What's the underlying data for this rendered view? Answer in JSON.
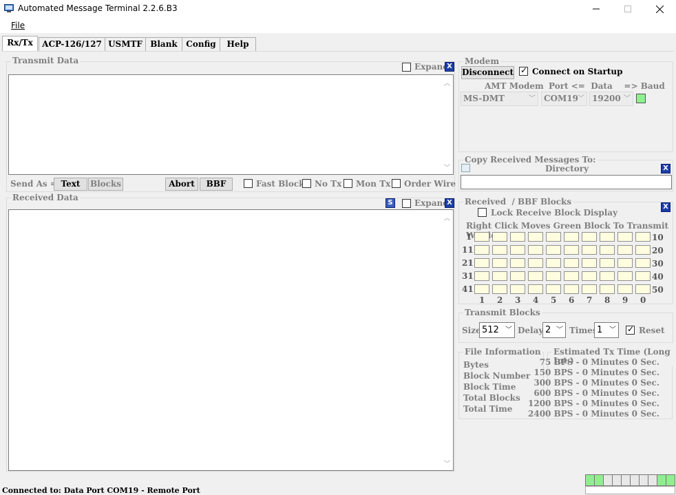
{
  "window": {
    "title": "Automated Message Terminal 2.2.6.B3"
  },
  "menu": {
    "file": "File"
  },
  "tabs": [
    "Rx/Tx",
    "ACP-126/127",
    "USMTF",
    "Blank",
    "Config",
    "Help"
  ],
  "transmit": {
    "label": "Transmit Data",
    "expand": "Expand",
    "close": "X",
    "send_as": "Send As =>",
    "text_btn": "Text",
    "blocks_btn": "Blocks",
    "abort_btn": "Abort",
    "bbf_btn": "BBF",
    "fast_block": "Fast Block",
    "no_tx": "No Tx",
    "mon_tx": "Mon Tx",
    "order_wire": "Order Wire"
  },
  "received": {
    "label": "Received Data",
    "expand": "Expand",
    "close": "X",
    "save_icon": "S"
  },
  "modem": {
    "label": "Modem",
    "disconnect": "Disconnect",
    "connect_startup": "Connect on Startup",
    "amt_modem_header": "AMT Modem",
    "port_header": "Port <=  Data    => Baud",
    "amt_modem_value": "MS-DMT",
    "port_value": "COM19",
    "baud_value": "19200",
    "status_color": "#90ee90"
  },
  "copy": {
    "label": "Copy Received Messages To:",
    "directory": "Directory",
    "close": "X",
    "value": ""
  },
  "bbf": {
    "label": "Received  / BBF Blocks",
    "lock": "Lock Receive Block Display",
    "hint": "Right Click Moves Green Block To Transmit WIndow",
    "close": "X",
    "row_left": [
      "1",
      "11",
      "21",
      "31",
      "41"
    ],
    "row_right": [
      "10",
      "20",
      "30",
      "40",
      "50"
    ],
    "cols": [
      "1",
      "2",
      "3",
      "4",
      "5",
      "6",
      "7",
      "8",
      "9",
      "0"
    ]
  },
  "tx_blocks": {
    "label": "Transmit Blocks",
    "size_label": "Size",
    "size": "512",
    "delay_label": "Delay",
    "delay": "2",
    "times_label": "Times",
    "times": "1",
    "reset": "Reset"
  },
  "file_info": {
    "label": "File Information",
    "items": [
      "Bytes",
      "Block Number",
      "Block Time",
      "Total Blocks",
      "Total Time"
    ]
  },
  "est": {
    "label": "Estimated Tx Time (Long Int.)",
    "rows": [
      "75 BPS - 0 Minutes 0 Sec.",
      "150 BPS - 0 Minutes 0 Sec.",
      "300 BPS - 0 Minutes 0 Sec.",
      "600 BPS - 0 Minutes 0 Sec.",
      "1200 BPS - 0 Minutes 0 Sec.",
      "2400 BPS - 0 Minutes 0 Sec."
    ]
  },
  "status": {
    "text": "Connected to: Data Port COM19 - Remote Port",
    "leds": [
      true,
      true,
      false,
      false,
      false,
      false,
      false,
      false,
      true,
      true
    ]
  }
}
